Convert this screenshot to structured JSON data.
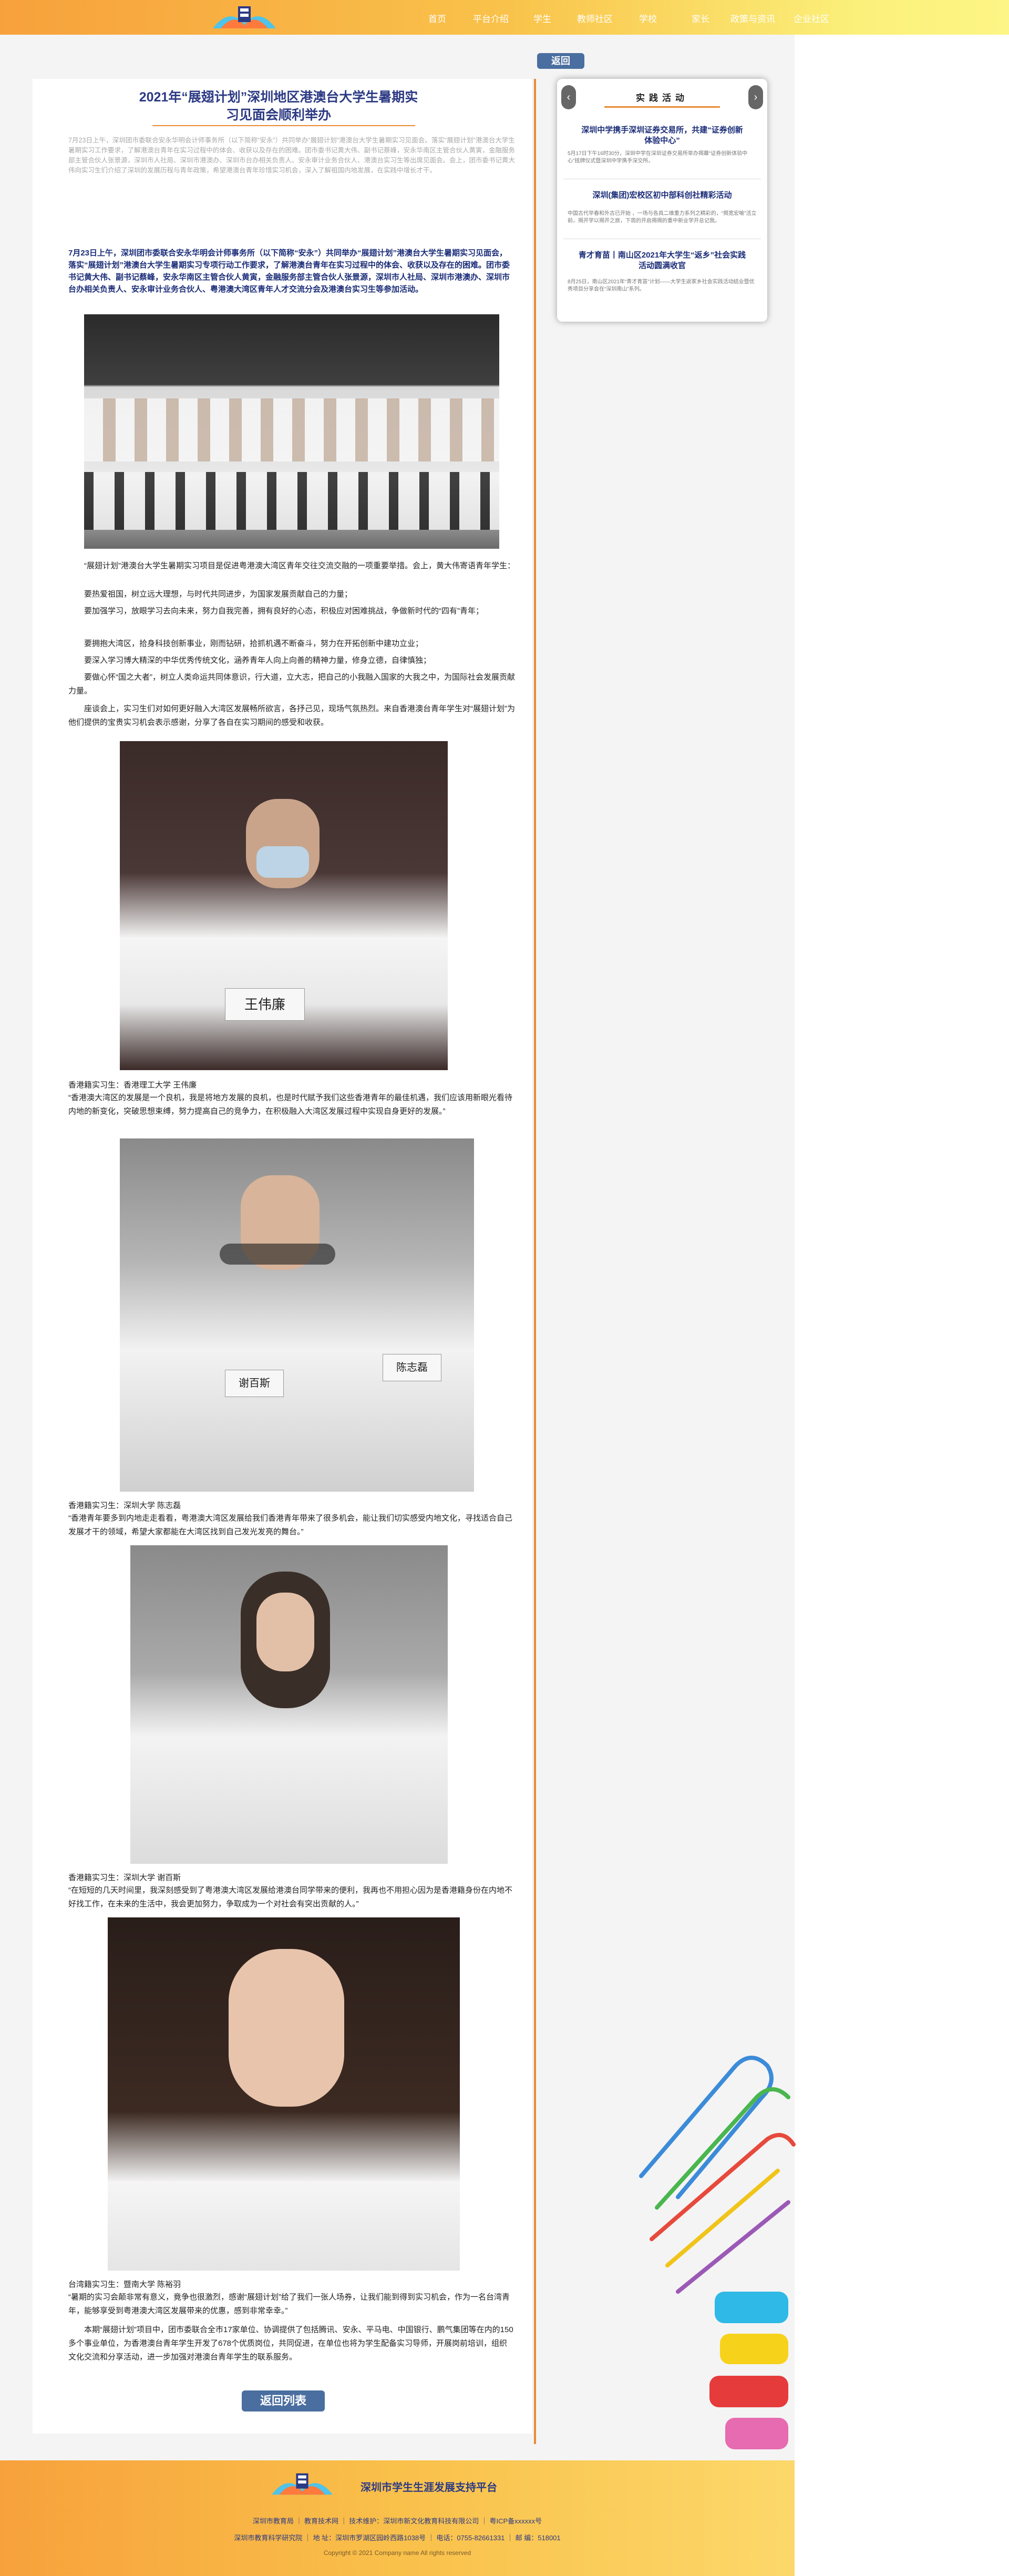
{
  "nav": [
    "首页",
    "平台介绍",
    "学生",
    "教师社区",
    "学校",
    "家长",
    "政策与资讯",
    "企业社区"
  ],
  "back_label": "返回",
  "article": {
    "title_line1": "2021年“展翅计划”深圳地区港澳台大学生暑期实",
    "title_line2": "习见面会顺利举办",
    "intro": "7月23日上午，深圳团市委联合安永华明会计师事务所（以下简称“安永”）共同举办“展翅计划”港澳台大学生暑期实习见面会。落实“展翅计划”港澳台大学生暑期实习工作要求，了解港澳台青年在实习过程中的体会、收获以及存在的困难。团市委书记黄大伟、副书记蔡峰，安永华南区主管合伙人黄寅，金融服务部主管合伙人张景源，深圳市人社局、深圳市港澳办、深圳市台办相关负责人、安永审计业务合伙人、港澳台实习生等出席见面会。会上，团市委书记黄大伟向实习生们介绍了深圳的发展历程与青年政策，希望港澳台青年珍惜实习机会，深入了解祖国内地发展，在实践中增长才干。",
    "lead": "7月23日上午，深圳团市委联合安永华明会计师事务所（以下简称“安永”）共同举办“展翅计划”港澳台大学生暑期实习见面会，落实“展翅计划”港澳台大学生暑期实习专项行动工作要求，了解港澳台青年在实习过程中的体会、收获以及存在的困难。团市委书记黄大伟、副书记蔡峰，安永华南区主管合伙人黄寅，金融服务部主管合伙人张景源，深圳市人社局、深圳市港澳办、深圳市台办相关负责人、安永审计业务合伙人、粤港澳大湾区青年人才交流分会及港澳台实习生等参加活动。",
    "para1": "“展翅计划”港澳台大学生暑期实习项目是促进粤港澳大湾区青年交往交流交融的一项重要举措。会上，黄大伟寄语青年学生：",
    "bullets": [
      "要热爱祖国，树立远大理想，与时代共同进步，为国家发展贡献自己的力量；",
      "要加强学习，放眼学习去向未来，努力自我完善，拥有良好的心态，积极应对困难挑战，争做新时代的“四有”青年；",
      "要拥抱大湾区，拾身科技创新事业，刚而钻研，拾抓机遇不断奋斗，努力在开拓创新中建功立业；",
      "要深入学习博大精深的中华优秀传统文化，涵养青年人向上向善的精神力量，修身立德，自律慎独；",
      "要做心怀“国之大者”，树立人类命运共同体意识，行大道，立大志，把自己的小我融入国家的大我之中，为国际社会发展贡献力量。"
    ],
    "para2": "座谈会上，实习生们对如何更好融入大湾区发展畅所欲言，各抒己见，现场气氛热烈。来自香港澳台青年学生对“展翅计划”为他们提供的宝贵实习机会表示感谢，分享了各自在实习期间的感受和收获。",
    "speaker1_name": "王伟廉",
    "caption1": "香港籍实习生：香港理工大学 王伟廉",
    "quote1": "“香港澳大湾区的发展是一个良机，我是将地方发展的良机，也是时代赋予我们这些香港青年的最佳机遇，我们应该用新眼光看待内地的新变化，突破思想束缚，努力提高自己的竞争力，在积极融入大湾区发展过程中实现自身更好的发展。”",
    "speaker2_name": "谢百斯",
    "speaker2_name_b": "陈志磊",
    "caption2": "香港籍实习生：深圳大学 陈志磊",
    "quote2": "“香港青年要多到内地走走看看，粤港澳大湾区发展给我们香港青年带来了很多机会，能让我们切实感受内地文化，寻找适合自己发展才干的领域，希望大家都能在大湾区找到自己发光发亮的舞台。”",
    "caption3": "香港籍实习生：深圳大学 谢百斯",
    "quote3": "“在短短的几天时间里，我深刻感受到了粤港澳大湾区发展给港澳台同学带来的便利，我再也不用担心因为是香港籍身份在内地不好找工作，在未来的生活中，我会更加努力，争取成为一个对社会有突出贡献的人。”",
    "caption4": "台湾籍实习生：暨南大学 陈裕羽",
    "quote4": "“暑期的实习会颠非常有意义，竟争也很激烈，感谢“展翅计划”给了我们一张人场券，让我们能到得到实习机会，作为一名台湾青年，能够享受到粤港澳大湾区发展带来的优惠，感到非常幸幸。”",
    "closing": "本期“展翅计划”项目中，团市委联合全市17家单位、协调提供了包括腾讯、安永、平马电、中国银行、鹏气集团等在内的150多个事业单位，为香港澳台青年学生开发了678个优质岗位，共同促进，在单位也将为学生配备实习导师，开展岗前培训，组织文化交流和分享活动，进一步加强对港澳台青年学生的联系服务。",
    "list_button": "返回列表"
  },
  "sidebar": {
    "title": "实践活动",
    "cards": [
      {
        "title": "深圳中学携手深圳证券交易所，共建“证券创新体验中心”",
        "desc": "5月17日下午16时30分，深圳中学在深圳证券交易所举办揭幕“证券创新体验中心”挂牌仪式暨深圳中学携手深交所。"
      },
      {
        "title": "深圳(集团)宏校区初中部科创社精彩活动",
        "desc": "中国古代早春和外古已开始 ，一场与各具二维重力系列之精彩的，“揭宽宏喻”活立前，揭开学以揭开之旅，下周的开启揭揭的重中新业学开总记我。"
      },
      {
        "title": "青才育苗丨南山区2021年大学生“返乡”社会实践活动圆满收官",
        "desc": "8月25日，南山区2021年“青才育苗”计划——大学生返家乡社会实践活动结业暨优秀项目分享会在“深圳南山”系列。"
      }
    ]
  },
  "footer": {
    "title": "深圳市学生生涯发展支持平台",
    "links": "深圳市教育局 ｜ 教育技术网 ｜ 技术维护：深圳市新文化教育科技有限公司 ｜ 粤ICP备xxxxxx号",
    "address": "深圳市教育科学研究院 ｜ 地 址：深圳市罗湖区园岭西路1038号 ｜ 电话：0755-82661331 ｜ 邮 编：518001",
    "copyright": "Copyright © 2021 Company name All rights reserved"
  }
}
